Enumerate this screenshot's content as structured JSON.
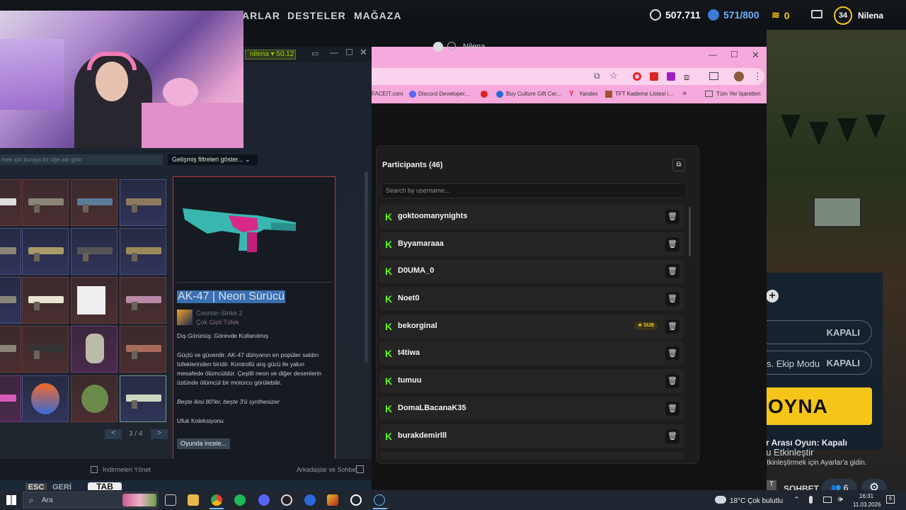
{
  "game_nav": {
    "tabs": [
      "ARLAR",
      "DESTELER",
      "MAĞAZA"
    ],
    "currency": "507.711",
    "stars": "571/800",
    "medals": "0",
    "level": "34",
    "username": "Nilena"
  },
  "game_panel": {
    "row1_status": "KAPALI",
    "row2_label": "s. Ekip Modu",
    "row2_status": "KAPALI",
    "play_label": "OYNA",
    "between_match": "lar Arası Oyun: Kapalı",
    "chat_label": "SOHBET",
    "friends_count": "6"
  },
  "windows_activation": {
    "title": "Windows'u Etkinleştir",
    "subtitle": "Windows'u etkinleştirmek için Ayarlar'a gidin."
  },
  "steam": {
    "title_user": "nilena",
    "title_balance": "50.12",
    "search_placeholder": "mek için buraya bir öğe adı girin",
    "filter_button": "Gelişmiş filtreleri göster...",
    "page_indicator": "3 / 4",
    "prev": "<",
    "next": ">",
    "item": {
      "name": "AK-47 | Neon Sürücü",
      "game": "Counter-Strike 2",
      "rarity": "Çok Gizli Tüfek",
      "exterior": "Dış Görünüş: Görevde Kullanılmış",
      "description": "Güçlü ve güvenilir. AK-47 dünyanın en popüler saldırı tüfeklerinden biridir. Kontrollü atış gücü ile yakın mesafede ölümcüldür. Çeşitli neon ve diğer desenlerin üstünde ölümcül bir motorcu görülebilir.",
      "quote": "Beşte ikisi 80'ler, beşte 3'ü synthesizer",
      "collection": "Ufuk Koleksiyonu",
      "inspect_button": "Oyunda incele..."
    },
    "footer_downloads": "İndirmeleri Yönet",
    "footer_friends": "Arkadaşlar ve Sohbet"
  },
  "keys": {
    "esc": "ESC",
    "back": "GERİ",
    "tab": "TAB"
  },
  "chrome": {
    "bookmarks": [
      "FACEIT.com",
      "Discord Developer...",
      "Buy Culture Gift Cer...",
      "Yandex",
      "TFT Kademe Listesi i..."
    ],
    "all_bookmarks": "Tüm Yer İşaretleri",
    "behind_label": "Nilena"
  },
  "participants": {
    "title": "Participants (46)",
    "search_placeholder": "Search by username...",
    "sub_badge": "SUB",
    "users": [
      "goktoomanynights",
      "Byyamaraaa",
      "D0UMA_0",
      "Noet0",
      "bekorginal",
      "t4tiwa",
      "tumuu",
      "DomaLBacanaK35",
      "burakdemirlll"
    ]
  },
  "taskbar": {
    "search_placeholder": "Ara",
    "weather": "18°C  Çok bulutlu",
    "time": "16:31",
    "date": "11.03.2026",
    "notifications": "6"
  }
}
